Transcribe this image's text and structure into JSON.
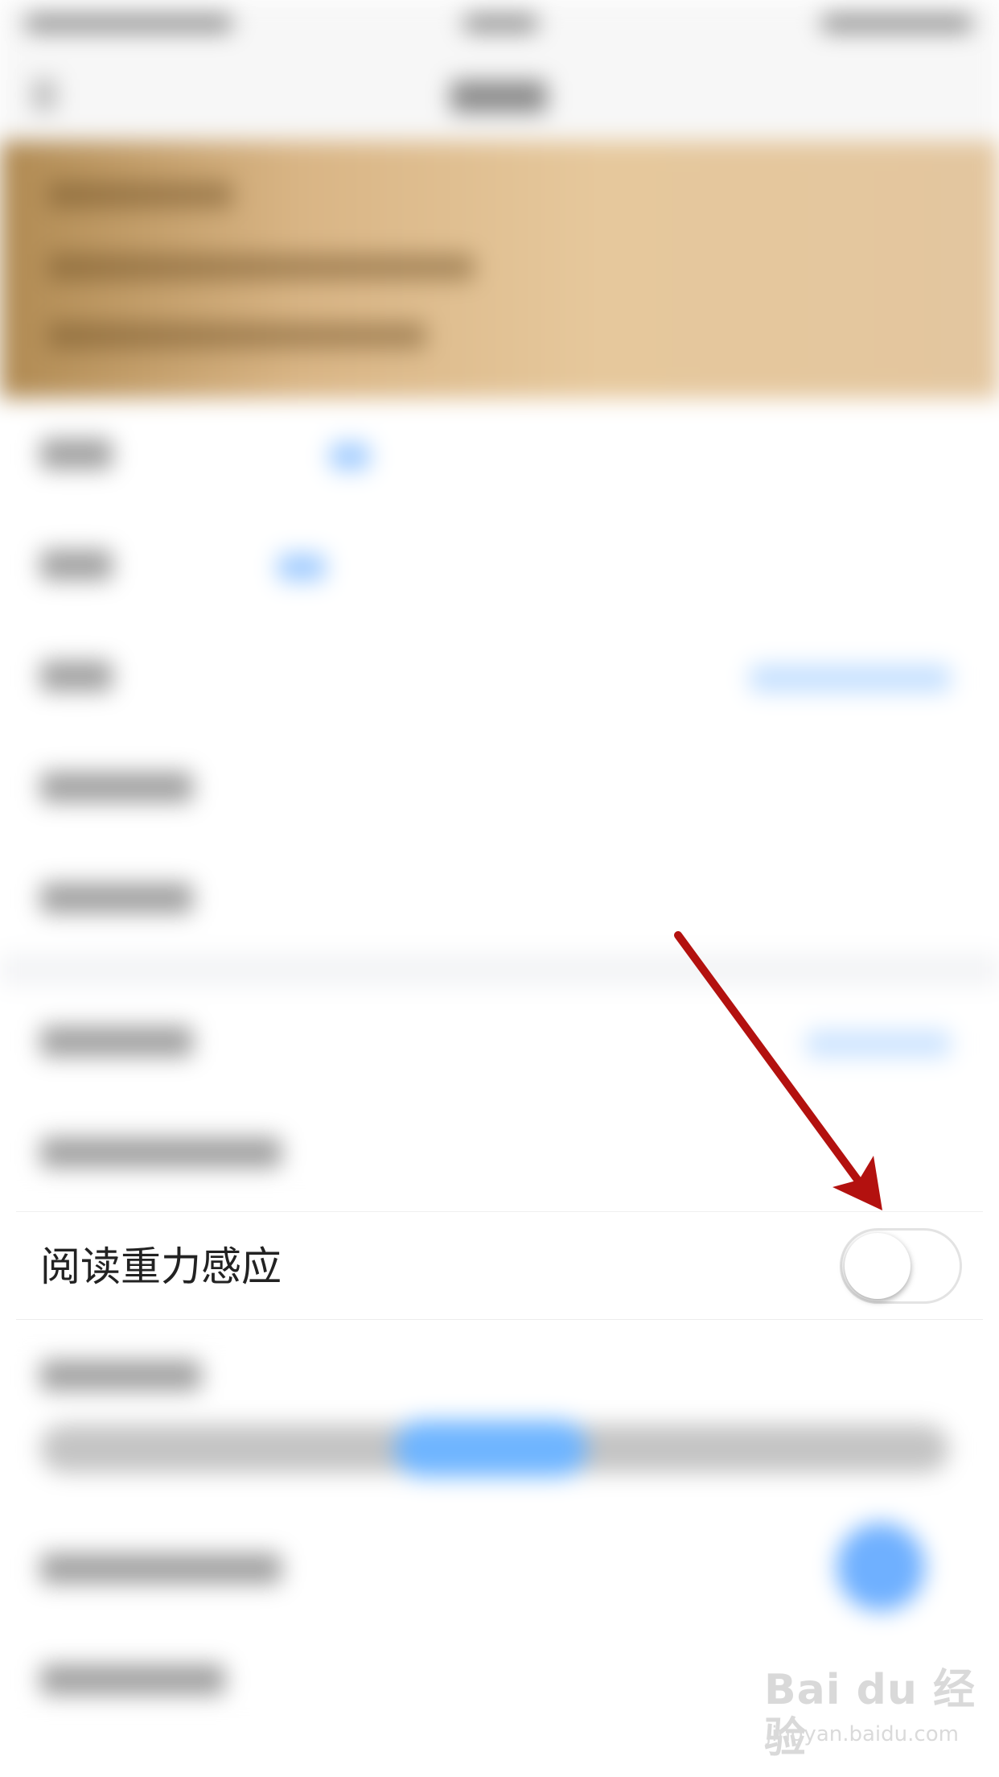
{
  "setting_row": {
    "label": "阅读重力感应",
    "toggle_on": false
  },
  "annotation": {
    "arrow_color": "#b3110f"
  },
  "watermark": {
    "brand": "Bai du 经验",
    "url": "jingyan.baidu.com"
  },
  "colors": {
    "banner": "#e3c69f",
    "accent": "#6fb5ff",
    "toggle_off_border": "#e3e3e3"
  }
}
